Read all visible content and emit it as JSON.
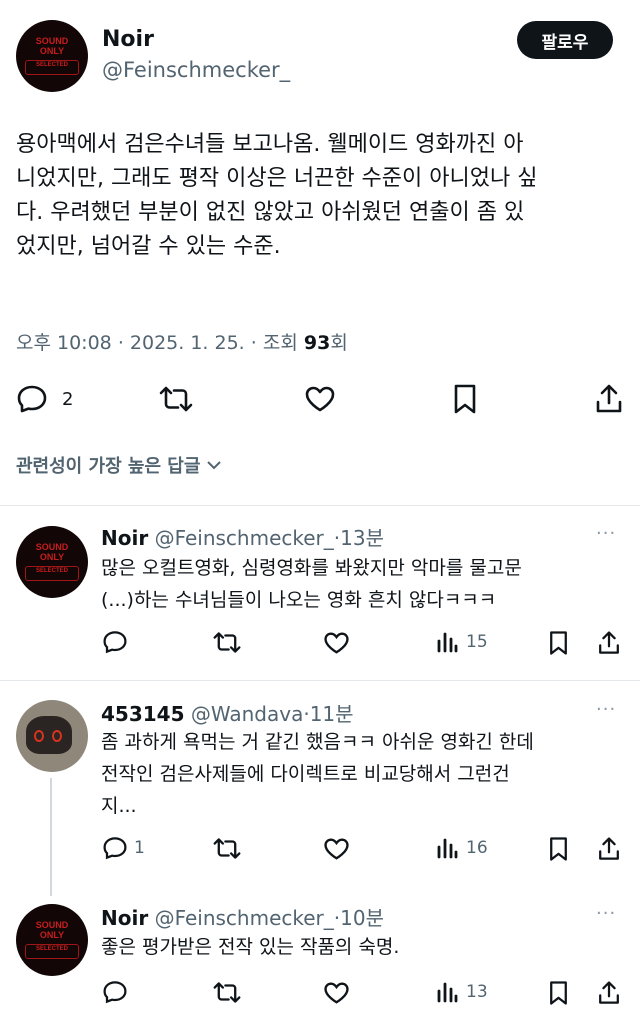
{
  "main_tweet": {
    "author_name": "Noir",
    "author_handle": "@Feinschmecker_",
    "avatar_text_top": "SOUND ONLY",
    "avatar_text_bottom": "SELECTED",
    "follow_label": "팔로우",
    "text_lines": [
      "용아맥에서 검은수녀들 보고나옴. 웰메이드 영화까진 아",
      "니었지만, 그래도 평작 이상은 너끈한 수준이 아니었나 싶",
      "다. 우려했던 부분이 없진 않았고 아쉬웠던 연출이 좀 있",
      "었지만, 넘어갈 수 있는 수준."
    ],
    "time": "오후 10:08",
    "date": "2025. 1. 25.",
    "views_label": "조회",
    "views_count": "93",
    "views_suffix": "회",
    "reply_count": "2"
  },
  "sort_label": "관련성이 가장 높은 답글",
  "replies": [
    {
      "author_name": "Noir",
      "author_handle": "@Feinschmecker_",
      "time_ago": "13분",
      "text_lines": [
        "많은 오컬트영화, 심령영화를 봐왔지만 악마를 물고문",
        "(...)하는 수녀님들이 나오는 영화 흔치 않다ㅋㅋㅋ"
      ],
      "reply_count": "",
      "views": "15"
    },
    {
      "author_name": "453145",
      "author_handle": "@Wandava",
      "time_ago": "11분",
      "text_lines": [
        "좀 과하게 욕먹는 거 같긴 했음ㅋㅋ 아쉬운 영화긴 한데",
        "전작인 검은사제들에 다이렉트로 비교당해서 그런건",
        "지..."
      ],
      "reply_count": "1",
      "views": "16"
    },
    {
      "author_name": "Noir",
      "author_handle": "@Feinschmecker_",
      "time_ago": "10분",
      "text_lines": [
        "좋은 평가받은 전작 있는 작품의 숙명."
      ],
      "reply_count": "",
      "views": "13"
    }
  ],
  "separator_dot": "·",
  "more_icon": "···",
  "colors": {
    "text": "#0f1419",
    "secondary": "#536471",
    "divider": "#e6e9ec",
    "avatar_red": "#c81d1d"
  }
}
